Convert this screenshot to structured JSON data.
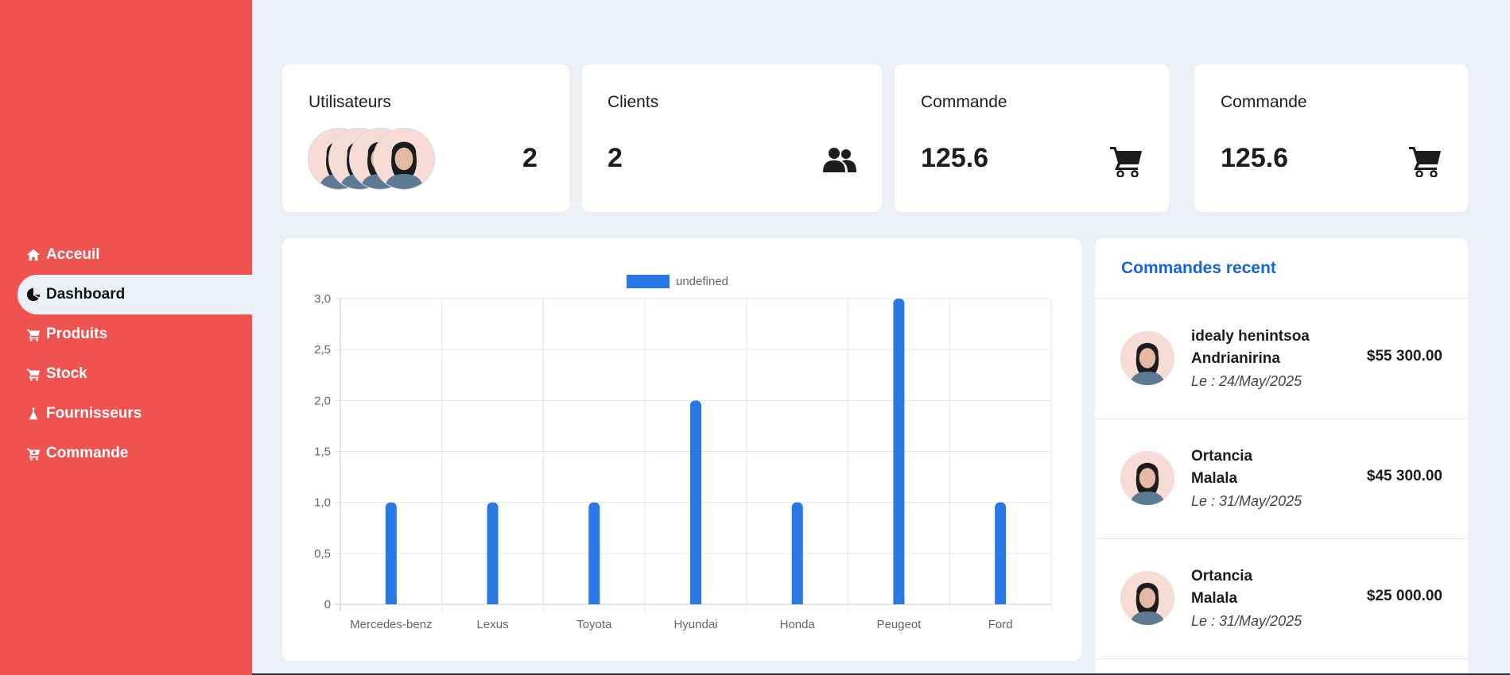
{
  "sidebar": {
    "items": [
      {
        "label": "Acceuil",
        "icon": "home-icon"
      },
      {
        "label": "Dashboard",
        "icon": "pie-chart-icon"
      },
      {
        "label": "Produits",
        "icon": "cart-icon"
      },
      {
        "label": "Stock",
        "icon": "cart-icon"
      },
      {
        "label": "Fournisseurs",
        "icon": "flask-icon"
      },
      {
        "label": "Commande",
        "icon": "cart-plus-icon"
      }
    ],
    "active_index": 1,
    "color": "#ef5350"
  },
  "stats": [
    {
      "title": "Utilisateurs",
      "value": "2",
      "icon": "avatars"
    },
    {
      "title": "Clients",
      "value": "2",
      "icon": "users-icon"
    },
    {
      "title": "Commande",
      "value": "125.6",
      "icon": "cart-icon"
    },
    {
      "title": "Commande",
      "value": "125.6",
      "icon": "cart-icon"
    }
  ],
  "chart_data": {
    "type": "bar",
    "categories": [
      "Mercedes-benz",
      "Lexus",
      "Toyota",
      "Hyundai",
      "Honda",
      "Peugeot",
      "Ford"
    ],
    "series": [
      {
        "name": "undefined",
        "values": [
          1,
          1,
          1,
          2,
          1,
          3,
          1
        ]
      }
    ],
    "y_ticks": [
      "0",
      "0,5",
      "1,0",
      "1,5",
      "2,0",
      "2,5",
      "3,0"
    ],
    "ylim": [
      0,
      3
    ],
    "grid": true,
    "legend": "top",
    "color": "#2a78e4"
  },
  "recent": {
    "title": "Commandes recent",
    "orders": [
      {
        "name": "idealy henintsoa Andrianirina",
        "date": "Le : 24/May/2025",
        "amount": "$55 300.00"
      },
      {
        "name": "Ortancia Malala",
        "date": "Le : 31/May/2025",
        "amount": "$45 300.00"
      },
      {
        "name": "Ortancia Malala",
        "date": "Le : 31/May/2025",
        "amount": "$25 000.00"
      }
    ]
  }
}
